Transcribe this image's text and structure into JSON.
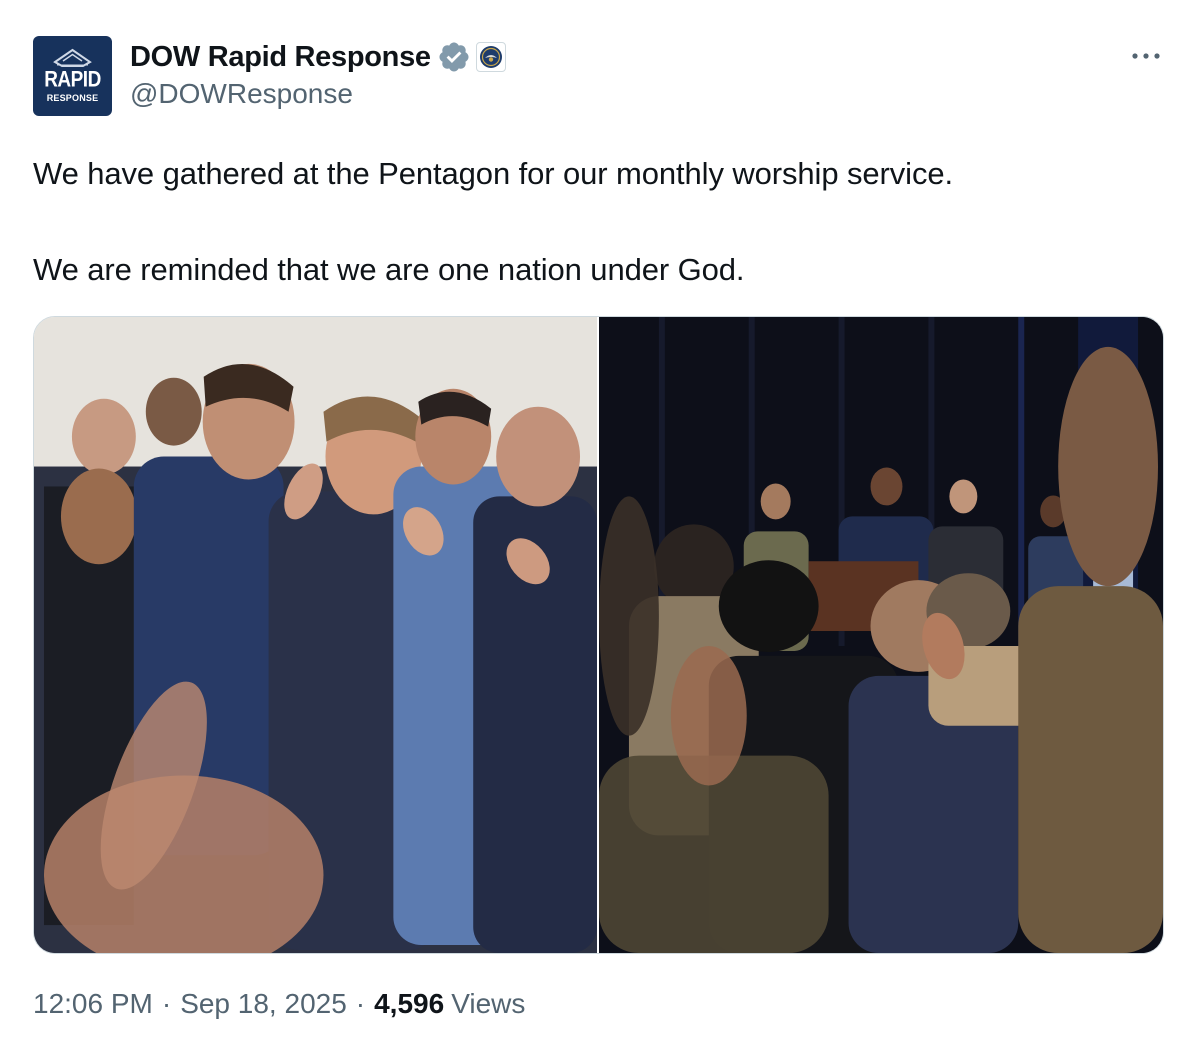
{
  "author": {
    "avatar_text_line1": "RAPID",
    "avatar_text_line2": "RESPONSE",
    "display_name": "DOW Rapid Response",
    "handle": "@DOWResponse",
    "verified_color": "#829aab"
  },
  "tweet": {
    "paragraphs": [
      "We have gathered at the Pentagon for our monthly worship service.",
      "We are reminded that we are one nation under God."
    ]
  },
  "media": {
    "photos": [
      {
        "description_icon": "photo-icon"
      },
      {
        "description_icon": "photo-icon"
      }
    ]
  },
  "meta": {
    "time": "12:06 PM",
    "separator": "·",
    "date": "Sep 18, 2025",
    "views_count": "4,596",
    "views_label": "Views"
  },
  "colors": {
    "text_primary": "#0f1419",
    "text_secondary": "#536471",
    "border": "#cfd9de",
    "avatar_bg": "#17325c"
  }
}
